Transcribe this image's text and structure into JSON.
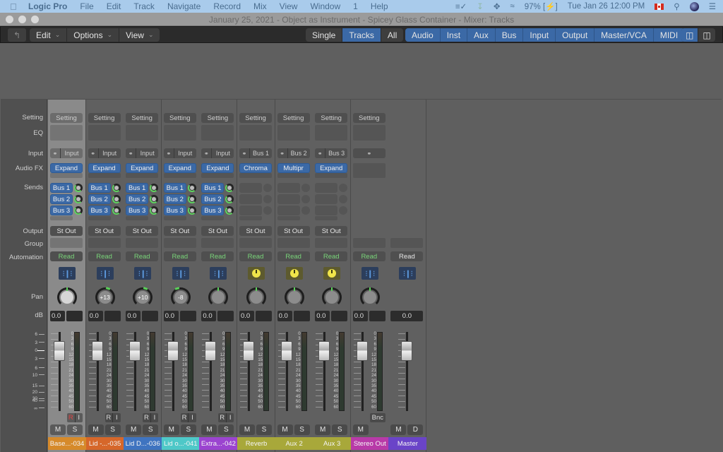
{
  "menubar": {
    "app_name": "Logic Pro",
    "items": [
      "File",
      "Edit",
      "Track",
      "Navigate",
      "Record",
      "Mix",
      "View",
      "Window",
      "1",
      "Help"
    ],
    "battery": "97%",
    "datetime": "Tue Jan 26  12:00 PM"
  },
  "window": {
    "title": "January 25, 2021 - Object as Instrument - Spicey Glass Container - Mixer: Tracks"
  },
  "toolbar": {
    "edit": "Edit",
    "options": "Options",
    "view": "View",
    "view_modes": [
      "Single",
      "Tracks",
      "All"
    ],
    "view_mode_active": "Tracks",
    "filters": [
      "Audio",
      "Inst",
      "Aux",
      "Bus",
      "Input",
      "Output",
      "Master/VCA",
      "MIDI"
    ]
  },
  "row_labels": {
    "setting": "Setting",
    "eq": "EQ",
    "input": "Input",
    "audio_fx": "Audio FX",
    "sends": "Sends",
    "output": "Output",
    "group": "Group",
    "automation": "Automation",
    "pan": "Pan",
    "db": "dB"
  },
  "fader_scale": [
    "6",
    "3",
    "0",
    "3",
    "6",
    "10",
    "15",
    "20",
    "30",
    "40",
    "∞"
  ],
  "meter_scale": [
    "0",
    "3",
    "6",
    "9",
    "12",
    "15",
    "18",
    "21",
    "24",
    "30",
    "35",
    "40",
    "45",
    "50",
    "60"
  ],
  "strips": [
    {
      "name": "Base...-034",
      "color": "#d68a2a",
      "setting": "Setting",
      "input": "Input",
      "fx": "Expand",
      "sends": [
        "Bus 1",
        "Bus 2",
        "Bus 3"
      ],
      "output": "St Out",
      "automation": "Read",
      "icon": "waveform",
      "pan": "",
      "db": "0.0",
      "ri": [
        "R",
        "I"
      ],
      "r_on": true,
      "ms": [
        "M",
        "S"
      ],
      "selected": true
    },
    {
      "name": "Lid -...-035",
      "color": "#d6672a",
      "setting": "Setting",
      "input": "Input",
      "fx": "Expand",
      "sends": [
        "Bus 1",
        "Bus 2",
        "Bus 3"
      ],
      "output": "St Out",
      "automation": "Read",
      "icon": "waveform",
      "pan": "+13",
      "db": "0.0",
      "ri": [
        "R",
        "I"
      ],
      "ms": [
        "M",
        "S"
      ]
    },
    {
      "name": "Lid D...-036",
      "color": "#3f74c0",
      "setting": "Setting",
      "input": "Input",
      "fx": "Expand",
      "sends": [
        "Bus 1",
        "Bus 2",
        "Bus 3"
      ],
      "output": "St Out",
      "automation": "Read",
      "icon": "waveform",
      "pan": "+10",
      "db": "0.0",
      "ri": [
        "R",
        "I"
      ],
      "ms": [
        "M",
        "S"
      ]
    },
    {
      "name": "Lid o...-041",
      "color": "#4ec8c8",
      "setting": "Setting",
      "input": "Input",
      "fx": "Expand",
      "sends": [
        "Bus 1",
        "Bus 2",
        "Bus 3"
      ],
      "output": "St Out",
      "automation": "Read",
      "icon": "waveform",
      "pan": "-8",
      "db": "0.0",
      "ri": [
        "R",
        "I"
      ],
      "ms": [
        "M",
        "S"
      ]
    },
    {
      "name": "Extra...-042",
      "color": "#9b44d0",
      "setting": "Setting",
      "input": "Input",
      "fx": "Expand",
      "sends": [
        "Bus 1",
        "Bus 2",
        "Bus 3"
      ],
      "output": "St Out",
      "automation": "Read",
      "icon": "waveform",
      "pan": "",
      "db": "0.0",
      "ri": [
        "R",
        "I"
      ],
      "ms": [
        "M",
        "S"
      ]
    },
    {
      "name": "Reverb",
      "color": "#a8a83a",
      "setting": "Setting",
      "input": "Bus 1",
      "fx": "Chroma",
      "sends": [],
      "output": "St Out",
      "automation": "Read",
      "icon": "knob",
      "pan": "",
      "db": "0.0",
      "ms": [
        "M",
        "S"
      ]
    },
    {
      "name": "Aux 2",
      "color": "#a8a83a",
      "setting": "Setting",
      "input": "Bus 2",
      "fx": "Multipr",
      "sends": [],
      "output": "St Out",
      "automation": "Read",
      "icon": "knob",
      "pan": "",
      "db": "0.0",
      "ms": [
        "M",
        "S"
      ]
    },
    {
      "name": "Aux 3",
      "color": "#a8a83a",
      "setting": "Setting",
      "input": "Bus 3",
      "fx": "Expand",
      "sends": [],
      "output": "St Out",
      "automation": "Read",
      "icon": "knob",
      "pan": "",
      "db": "0.0",
      "ms": [
        "M",
        "S"
      ]
    },
    {
      "name": "Stereo Out",
      "color": "#b83aa8",
      "setting": "Setting",
      "input": "",
      "fx": "",
      "sends": null,
      "output": "",
      "automation": "Read",
      "icon": "waveform",
      "pan": "",
      "db": "0.0",
      "bnc": "Bnc",
      "ms": [
        "M"
      ]
    },
    {
      "name": "Master",
      "color": "#6a44c8",
      "setting": null,
      "input": null,
      "fx": null,
      "sends": null,
      "output": null,
      "automation": "Read",
      "automation_white": true,
      "icon": "waveform",
      "pan": null,
      "db": "0.0",
      "ms": [
        "M",
        "D"
      ],
      "master": true
    }
  ]
}
